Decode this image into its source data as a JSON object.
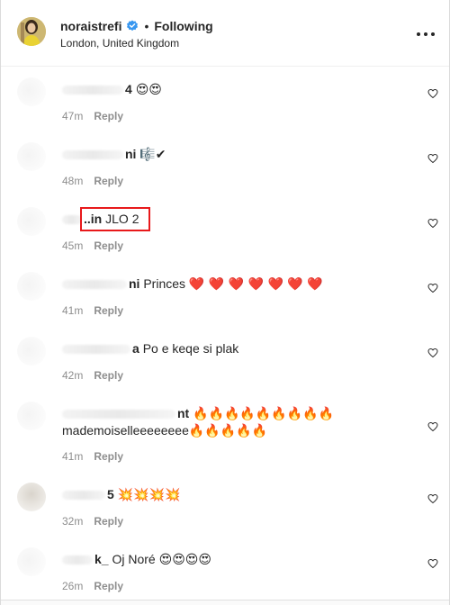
{
  "header": {
    "username": "noraistrefi",
    "follow_status": "Following",
    "location": "London, United Kingdom"
  },
  "comments": [
    {
      "name_tail": "4",
      "text": "",
      "emoji": "😍😍",
      "time": "47m",
      "reply": "Reply"
    },
    {
      "name_tail": "ni",
      "text": "",
      "emoji": "🎼✔",
      "time": "48m",
      "reply": "Reply"
    },
    {
      "name_tail": "..in",
      "text": "JLO 2",
      "emoji": "",
      "time": "45m",
      "reply": "Reply"
    },
    {
      "name_tail": "ni",
      "text": "Princes",
      "emoji": "❤️ ❤️ ❤️ ❤️ ❤️ ❤️ ❤️",
      "time": "41m",
      "reply": "Reply"
    },
    {
      "name_tail": "a",
      "text": "Po e keqe si plak",
      "emoji": "",
      "time": "42m",
      "reply": "Reply"
    },
    {
      "name_tail": "nt",
      "text": "",
      "emoji": "🔥🔥🔥🔥🔥🔥🔥🔥🔥",
      "line2": "mademoiselleeeeeeee",
      "emoji2": "🔥🔥🔥🔥🔥",
      "time": "41m",
      "reply": "Reply"
    },
    {
      "name_tail": "5",
      "text": "",
      "emoji": "💥💥💥💥",
      "time": "32m",
      "reply": "Reply"
    },
    {
      "name_tail": "k_",
      "text": "Oj Noré",
      "emoji": "😍😍😍😍",
      "time": "26m",
      "reply": "Reply"
    }
  ],
  "colors": {
    "verified_blue": "#3897f0",
    "highlight_red": "#e8191b",
    "meta_gray": "#8e8e8e"
  },
  "icons": [
    "verified-badge-icon",
    "more-options-icon",
    "heart-icon"
  ]
}
